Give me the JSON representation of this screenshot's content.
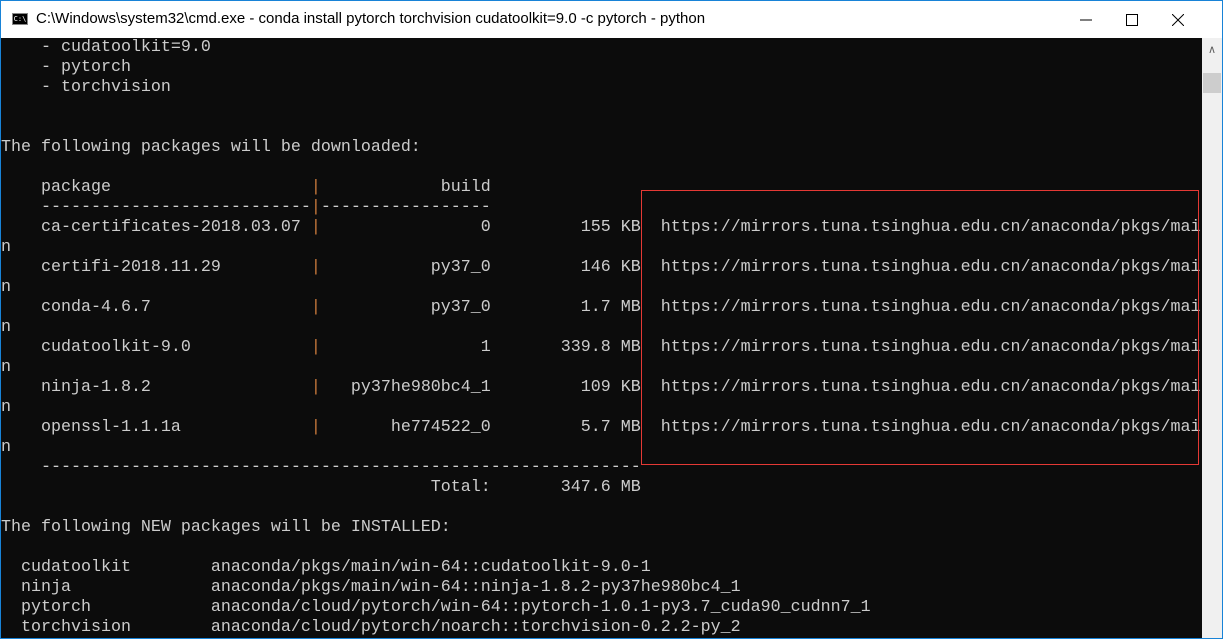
{
  "window": {
    "title": "C:\\Windows\\system32\\cmd.exe - conda  install pytorch torchvision cudatoolkit=9.0 -c pytorch - python",
    "icon_text": "C:\\",
    "controls": [
      "minimize-icon",
      "maximize-icon",
      "close-icon"
    ]
  },
  "terminal": {
    "specs": [
      "cudatoolkit=9.0",
      "pytorch",
      "torchvision"
    ],
    "download_heading": "The following packages will be downloaded:",
    "col_package": "package",
    "col_build": "build",
    "packages": [
      {
        "name": "ca-certificates-2018.03.07",
        "build": "0",
        "size": "155 KB",
        "url": "https://mirrors.tuna.tsinghua.edu.cn/anaconda/pkgs/mai",
        "wrap": "n"
      },
      {
        "name": "certifi-2018.11.29",
        "build": "py37_0",
        "size": "146 KB",
        "url": "https://mirrors.tuna.tsinghua.edu.cn/anaconda/pkgs/mai",
        "wrap": "n"
      },
      {
        "name": "conda-4.6.7",
        "build": "py37_0",
        "size": "1.7 MB",
        "url": "https://mirrors.tuna.tsinghua.edu.cn/anaconda/pkgs/mai",
        "wrap": "n"
      },
      {
        "name": "cudatoolkit-9.0",
        "build": "1",
        "size": "339.8 MB",
        "url": "https://mirrors.tuna.tsinghua.edu.cn/anaconda/pkgs/mai",
        "wrap": "n"
      },
      {
        "name": "ninja-1.8.2",
        "build": "py37he980bc4_1",
        "size": "109 KB",
        "url": "https://mirrors.tuna.tsinghua.edu.cn/anaconda/pkgs/mai",
        "wrap": "n"
      },
      {
        "name": "openssl-1.1.1a",
        "build": "he774522_0",
        "size": "5.7 MB",
        "url": "https://mirrors.tuna.tsinghua.edu.cn/anaconda/pkgs/mai",
        "wrap": "n"
      }
    ],
    "total_label": "Total:",
    "total_size": "347.6 MB",
    "install_heading": "The following NEW packages will be INSTALLED:",
    "installs": [
      {
        "name": "cudatoolkit",
        "spec": "anaconda/pkgs/main/win-64::cudatoolkit-9.0-1"
      },
      {
        "name": "ninja",
        "spec": "anaconda/pkgs/main/win-64::ninja-1.8.2-py37he980bc4_1"
      },
      {
        "name": "pytorch",
        "spec": "anaconda/cloud/pytorch/win-64::pytorch-1.0.1-py3.7_cuda90_cudnn7_1"
      },
      {
        "name": "torchvision",
        "spec": "anaconda/cloud/pytorch/noarch::torchvision-0.2.2-py_2"
      }
    ]
  },
  "colors": {
    "background": "#0c0c0c",
    "text": "#cccccc",
    "separator": "#c8783c",
    "highlight_box": "#e53935",
    "window_border": "#1883d7"
  }
}
